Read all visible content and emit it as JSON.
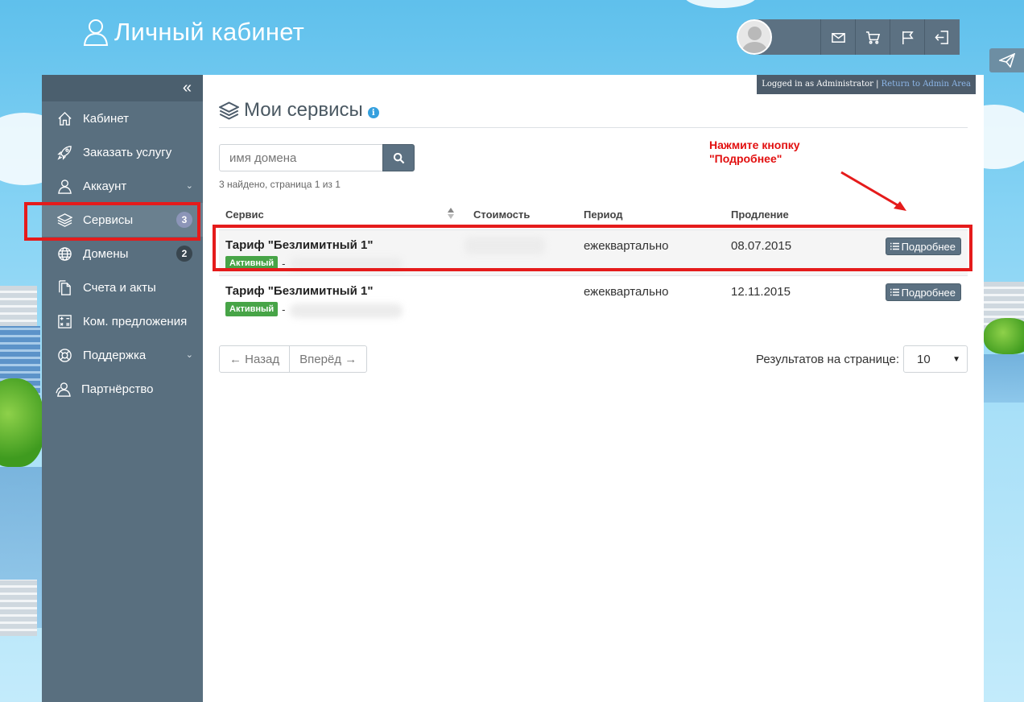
{
  "header": {
    "brand_title": "Личный кабинет",
    "icons": [
      "user-outline-icon",
      "mail-icon",
      "cart-icon",
      "flag-icon",
      "logout-icon",
      "paper-plane-icon"
    ]
  },
  "sidebar": {
    "collapse_glyph": "«",
    "items": [
      {
        "label": "Кабинет",
        "icon": "home-icon"
      },
      {
        "label": "Заказать услугу",
        "icon": "rocket-icon"
      },
      {
        "label": "Аккаунт",
        "icon": "user-icon",
        "has_submenu": true
      },
      {
        "label": "Сервисы",
        "icon": "layers-icon",
        "badge": "3",
        "active": true
      },
      {
        "label": "Домены",
        "icon": "globe-icon",
        "badge": "2"
      },
      {
        "label": "Счета и акты",
        "icon": "document-icon"
      },
      {
        "label": "Ком. предложения",
        "icon": "calculator-icon"
      },
      {
        "label": "Поддержка",
        "icon": "lifebuoy-icon",
        "has_submenu": true
      },
      {
        "label": "Партнёрство",
        "icon": "users-icon"
      }
    ]
  },
  "admin_banner": {
    "text": "Logged in as Administrator |",
    "link": "Return to Admin Area"
  },
  "page": {
    "title": "Мои сервисы",
    "info_glyph": "i",
    "search_placeholder": "имя домена",
    "search_value": "",
    "results_text": "3 найдено, страница 1 из 1"
  },
  "table": {
    "headers": [
      "Сервис",
      "Стоимость",
      "Период",
      "Продление"
    ],
    "rows": [
      {
        "service": "Тариф \"Безлимитный 1\"",
        "status": "Активный",
        "domain": "-",
        "price": "",
        "period": "ежеквартально",
        "renewal": "08.07.2015",
        "action": "Подробнее"
      },
      {
        "service": "Тариф \"Безлимитный 1\"",
        "status": "Активный",
        "domain": "-",
        "price": "",
        "period": "ежеквартально",
        "renewal": "12.11.2015",
        "action": "Подробнее"
      }
    ]
  },
  "pagination": {
    "prev": "← Назад",
    "next": "Вперёд →",
    "per_page_label": "Результатов на странице:",
    "per_page_value": "10"
  },
  "annotation": {
    "line1": "Нажмите кнопку",
    "line2": "\"Подробнее\"",
    "color": "#e20f0f"
  },
  "colors": {
    "sidebar_bg": "#596f7f",
    "accent_button": "#5c7182",
    "status_green": "#47a447",
    "highlight_red": "#e51b1b"
  }
}
